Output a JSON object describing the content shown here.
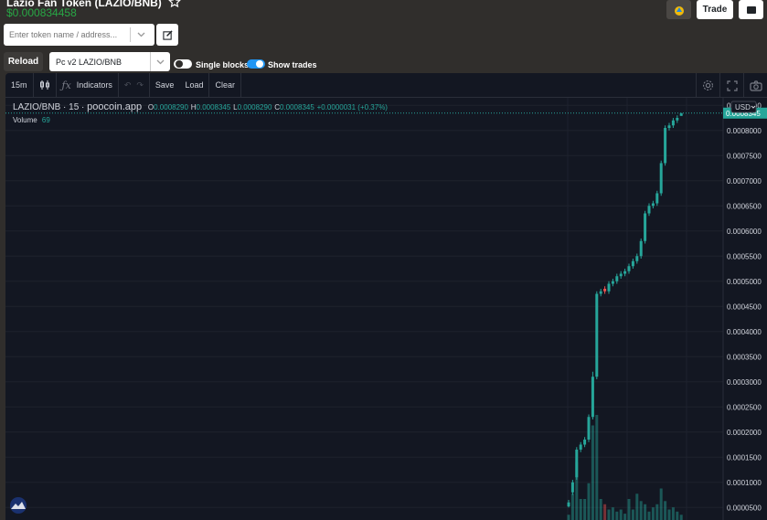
{
  "token": {
    "title": "Lazio Fan Token (LAZIO/BNB)",
    "price": "$0.000834458"
  },
  "top_right": {
    "trade_label": "Trade"
  },
  "search": {
    "placeholder": "Enter token name / address..."
  },
  "controls": {
    "reload_label": "Reload",
    "pair_value": "Pc v2 LAZIO/BNB",
    "single_blocks_label": "Single blocks",
    "single_blocks_on": false,
    "show_trades_label": "Show trades",
    "show_trades_on": true
  },
  "chart_toolbar": {
    "interval": "15m",
    "indicators_label": "Indicators",
    "save_label": "Save",
    "load_label": "Load",
    "clear_label": "Clear"
  },
  "legend": {
    "pair": "LAZIO/BNB",
    "interval": "15",
    "source": "poocoin.app",
    "o_key": "O",
    "o": "0.0008290",
    "h_key": "H",
    "h": "0.0008345",
    "l_key": "L",
    "l": "0.0008290",
    "c_key": "C",
    "c": "0.0008345",
    "change": "+0.0000031 (+0.37%)",
    "volume_label": "Volume",
    "volume_value": "69"
  },
  "colors": {
    "up": "#26a69a",
    "down": "#ef5350",
    "bg": "#131722",
    "grid": "#1e222d",
    "accent_price": "#26a69a"
  },
  "chart_data": {
    "type": "candlestick",
    "currency": "USD",
    "current_price_label": "0.0008345",
    "y_ticks": [
      "0.0008500",
      "0.0008000",
      "0.0007500",
      "0.0007000",
      "0.0006500",
      "0.0006000",
      "0.0005500",
      "0.0005000",
      "0.0004500",
      "0.0004000",
      "0.0003500",
      "0.0003000",
      "0.0002500",
      "0.0002000",
      "0.0001500",
      "0.0001000",
      "0.0000500"
    ],
    "ylim": [
      2.5e-05,
      0.000865
    ],
    "candles": [
      {
        "o": 5.2e-05,
        "h": 6.5e-05,
        "l": 5e-05,
        "c": 6e-05
      },
      {
        "o": 8e-05,
        "h": 0.000105,
        "l": 7.5e-05,
        "c": 0.0001
      },
      {
        "o": 0.00011,
        "h": 0.00017,
        "l": 0.000105,
        "c": 0.000165
      },
      {
        "o": 0.000165,
        "h": 0.00018,
        "l": 0.00016,
        "c": 0.000175
      },
      {
        "o": 0.000175,
        "h": 0.00019,
        "l": 0.00017,
        "c": 0.000185
      },
      {
        "o": 0.000185,
        "h": 0.000235,
        "l": 0.00018,
        "c": 0.00023
      },
      {
        "o": 0.00023,
        "h": 0.00032,
        "l": 0.000225,
        "c": 0.00031
      },
      {
        "o": 0.00031,
        "h": 0.00048,
        "l": 0.000305,
        "c": 0.000475
      },
      {
        "o": 0.000475,
        "h": 0.000485,
        "l": 0.00047,
        "c": 0.00048
      },
      {
        "o": 0.000485,
        "h": 0.00049,
        "l": 0.000475,
        "c": 0.00048
      },
      {
        "o": 0.00048,
        "h": 0.0005,
        "l": 0.000475,
        "c": 0.000495
      },
      {
        "o": 0.000495,
        "h": 0.000505,
        "l": 0.00049,
        "c": 0.0005
      },
      {
        "o": 0.0005,
        "h": 0.000515,
        "l": 0.000495,
        "c": 0.00051
      },
      {
        "o": 0.00051,
        "h": 0.00052,
        "l": 0.000505,
        "c": 0.000515
      },
      {
        "o": 0.000515,
        "h": 0.000525,
        "l": 0.00051,
        "c": 0.00052
      },
      {
        "o": 0.00052,
        "h": 0.000535,
        "l": 0.000515,
        "c": 0.00053
      },
      {
        "o": 0.00053,
        "h": 0.000545,
        "l": 0.000525,
        "c": 0.00054
      },
      {
        "o": 0.00054,
        "h": 0.000555,
        "l": 0.000535,
        "c": 0.00055
      },
      {
        "o": 0.00055,
        "h": 0.000585,
        "l": 0.000545,
        "c": 0.00058
      },
      {
        "o": 0.00058,
        "h": 0.00064,
        "l": 0.000575,
        "c": 0.000635
      },
      {
        "o": 0.000635,
        "h": 0.000655,
        "l": 0.00063,
        "c": 0.00065
      },
      {
        "o": 0.00065,
        "h": 0.00066,
        "l": 0.000645,
        "c": 0.000655
      },
      {
        "o": 0.000655,
        "h": 0.00068,
        "l": 0.00065,
        "c": 0.000675
      },
      {
        "o": 0.000675,
        "h": 0.00074,
        "l": 0.00067,
        "c": 0.000735
      },
      {
        "o": 0.000735,
        "h": 0.00081,
        "l": 0.00073,
        "c": 0.000805
      },
      {
        "o": 0.000805,
        "h": 0.000815,
        "l": 0.0008,
        "c": 0.00081
      },
      {
        "o": 0.00081,
        "h": 0.000825,
        "l": 0.000805,
        "c": 0.00082
      },
      {
        "o": 0.00082,
        "h": 0.00083,
        "l": 0.000815,
        "c": 0.000825
      },
      {
        "o": 0.000829,
        "h": 0.0008345,
        "l": 0.000829,
        "c": 0.0008345
      }
    ],
    "volume_relative": [
      0.05,
      0.25,
      0.55,
      0.2,
      0.2,
      0.35,
      0.9,
      1.0,
      0.2,
      0.15,
      0.1,
      0.12,
      0.08,
      0.1,
      0.06,
      0.2,
      0.1,
      0.25,
      0.18,
      0.15,
      0.08,
      0.12,
      0.15,
      0.3,
      0.18,
      0.1,
      0.12,
      0.08,
      0.05
    ],
    "down_indices": [
      9
    ]
  }
}
